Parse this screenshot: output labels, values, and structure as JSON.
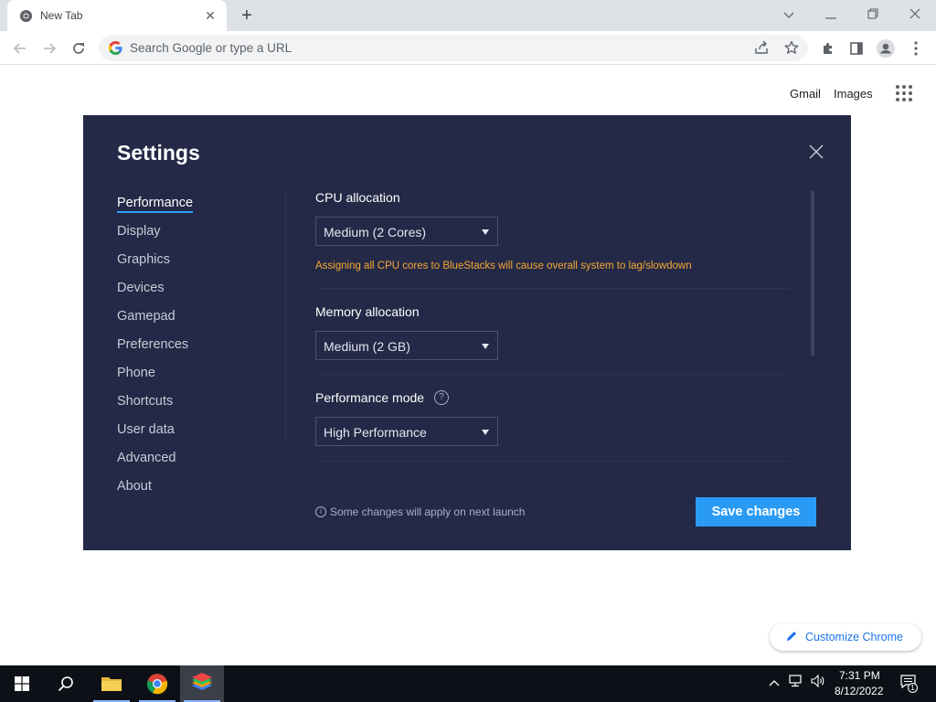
{
  "browser": {
    "tab_title": "New Tab",
    "tab_close": "✕",
    "new_tab": "+",
    "omnibox_placeholder": "Search Google or type a URL",
    "colors": {
      "tabstrip": "#dee1e6",
      "omnibox": "#f1f3f4"
    }
  },
  "ntp": {
    "gmail": "Gmail",
    "images": "Images",
    "customize": "Customize Chrome"
  },
  "settings": {
    "title": "Settings",
    "nav": [
      {
        "label": "Performance",
        "active": true
      },
      {
        "label": "Display"
      },
      {
        "label": "Graphics"
      },
      {
        "label": "Devices"
      },
      {
        "label": "Gamepad"
      },
      {
        "label": "Preferences"
      },
      {
        "label": "Phone"
      },
      {
        "label": "Shortcuts"
      },
      {
        "label": "User data"
      },
      {
        "label": "Advanced"
      },
      {
        "label": "About"
      }
    ],
    "cpu": {
      "label": "CPU allocation",
      "value": "Medium (2 Cores)",
      "warning": "Assigning all CPU cores to BlueStacks will cause overall system to lag/slowdown"
    },
    "memory": {
      "label": "Memory allocation",
      "value": "Medium (2 GB)"
    },
    "perf_mode": {
      "label": "Performance mode",
      "value": "High Performance"
    },
    "footer_note": "Some changes will apply on next launch",
    "save_label": "Save changes",
    "colors": {
      "background": "#232946",
      "accent": "#2a9bf5",
      "warning": "#f7a835"
    }
  },
  "taskbar": {
    "time": "7:31 PM",
    "date": "8/12/2022",
    "notifications": "1"
  }
}
